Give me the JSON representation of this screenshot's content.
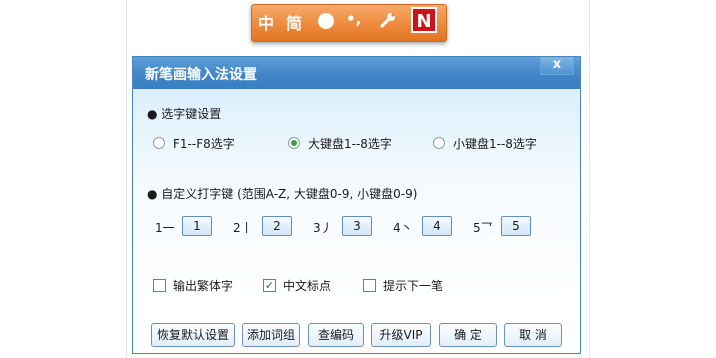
{
  "ime_toolbar": {
    "mode_label": "中",
    "charset_label": "简",
    "full_width_icon": "circle-icon",
    "punct_label": "•,",
    "settings_icon": "wrench-icon",
    "logo_text": "N"
  },
  "dialog": {
    "title": "新笔画输入法设置",
    "close_label": "x",
    "select_key_section": {
      "heading": "● 选字键设置",
      "options": [
        {
          "label": "F1--F8选字",
          "checked": false
        },
        {
          "label": "大键盘1--8选字",
          "checked": true
        },
        {
          "label": "小键盘1--8选字",
          "checked": false
        }
      ]
    },
    "custom_keys_section": {
      "heading": "● 自定义打字键 (范围A-Z, 大键盘0-9, 小键盘0-9)",
      "keys": [
        {
          "stroke": "1一",
          "value": "1"
        },
        {
          "stroke": "2丨",
          "value": "2"
        },
        {
          "stroke": "3丿",
          "value": "3"
        },
        {
          "stroke": "4丶",
          "value": "4"
        },
        {
          "stroke": "5乛",
          "value": "5"
        }
      ]
    },
    "checkboxes": [
      {
        "label": "输出繁体字",
        "checked": false
      },
      {
        "label": "中文标点",
        "checked": true
      },
      {
        "label": "提示下一笔",
        "checked": false
      }
    ],
    "buttons": {
      "restore_default": "恢复默认设置",
      "add_phrase": "添加词组",
      "lookup_code": "查编码",
      "upgrade_vip": "升级VIP",
      "ok": "确 定",
      "cancel": "取 消"
    }
  }
}
